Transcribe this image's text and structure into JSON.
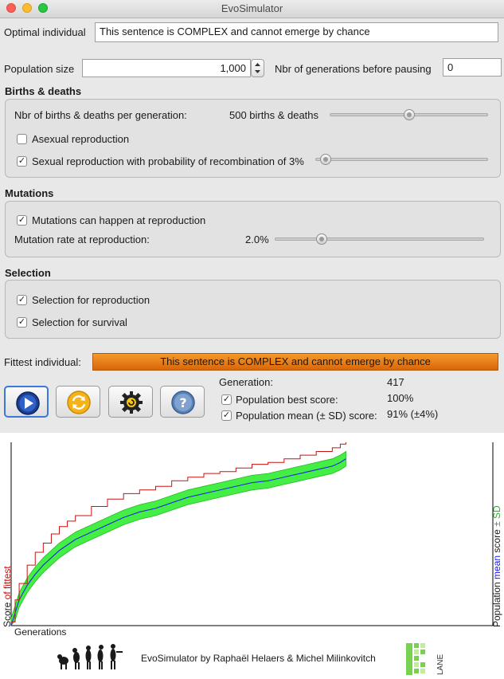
{
  "window": {
    "title": "EvoSimulator"
  },
  "optimal": {
    "label": "Optimal individual",
    "value": "This sentence is COMPLEX and cannot emerge by chance"
  },
  "population": {
    "label": "Population size",
    "value": "1,000",
    "pause_label": "Nbr of generations before pausing",
    "pause_value": "0"
  },
  "births": {
    "title": "Births & deaths",
    "per_gen_label": "Nbr of births & deaths per generation:",
    "per_gen_value": "500 births & deaths",
    "per_gen_level": 0.5,
    "asexual_label": "Asexual reproduction",
    "asexual_checked": false,
    "sexual_label": "Sexual reproduction with probability of recombination of 3%",
    "sexual_checked": true,
    "recombination_level": 0.03
  },
  "mutations": {
    "title": "Mutations",
    "enabled_label": "Mutations can happen at reproduction",
    "enabled_checked": true,
    "rate_label": "Mutation rate at reproduction:",
    "rate_value": "2.0%",
    "rate_level": 0.21
  },
  "selection": {
    "title": "Selection",
    "reproduction_label": "Selection for reproduction",
    "reproduction_checked": true,
    "survival_label": "Selection for survival",
    "survival_checked": true
  },
  "fittest": {
    "label": "Fittest individual:",
    "value": "This sentence is COMPLEX and cannot emerge by chance"
  },
  "stats": {
    "generation_label": "Generation:",
    "generation_value": "417",
    "best_label": "Population best score:",
    "best_value": "100%",
    "best_checked": true,
    "mean_label": "Population mean (± SD) score:",
    "mean_value": "91% (±4%)",
    "mean_checked": true
  },
  "toolbar": {
    "play": "play-icon",
    "reset": "reset-icon",
    "settings": "settings-icon",
    "help": "help-icon"
  },
  "chart_data": {
    "type": "line",
    "xlabel": "Generations",
    "ylabel_left": {
      "prefix": "Score ",
      "highlight": "of fittest"
    },
    "ylabel_right": {
      "prefix": "Population ",
      "mean": "mean",
      "mid": " score ",
      "sd": "± SD"
    },
    "colors": {
      "best": "#cc1111",
      "mean": "#1a1aee",
      "sd": "#44ee44",
      "sd_edge": "#22bb22"
    },
    "x_max": 600,
    "ylim": [
      0,
      1
    ],
    "series": [
      {
        "x": [
          0,
          5,
          10,
          20,
          30,
          40,
          50,
          60,
          70,
          80,
          100,
          120,
          140,
          160,
          180,
          200,
          220,
          240,
          260,
          280,
          300,
          320,
          340,
          360,
          380,
          400,
          410,
          417
        ],
        "values": [
          0.02,
          0.14,
          0.23,
          0.33,
          0.4,
          0.45,
          0.5,
          0.54,
          0.57,
          0.6,
          0.65,
          0.69,
          0.72,
          0.74,
          0.76,
          0.79,
          0.81,
          0.83,
          0.84,
          0.86,
          0.88,
          0.89,
          0.91,
          0.93,
          0.95,
          0.97,
          0.99,
          1.0
        ]
      },
      {
        "x": [
          0,
          5,
          10,
          20,
          30,
          40,
          50,
          60,
          70,
          80,
          100,
          120,
          140,
          160,
          180,
          200,
          220,
          240,
          260,
          280,
          300,
          320,
          340,
          360,
          380,
          400,
          410,
          417
        ],
        "values": [
          0.0,
          0.07,
          0.14,
          0.22,
          0.28,
          0.33,
          0.37,
          0.41,
          0.44,
          0.47,
          0.51,
          0.55,
          0.59,
          0.62,
          0.64,
          0.67,
          0.7,
          0.72,
          0.74,
          0.76,
          0.78,
          0.79,
          0.81,
          0.83,
          0.85,
          0.87,
          0.89,
          0.91
        ],
        "sd": 0.04
      }
    ]
  },
  "footer": {
    "credit": "EvoSimulator by Raphaël Helaers & Michel Milinkovitch",
    "logo_text": "LANE"
  }
}
